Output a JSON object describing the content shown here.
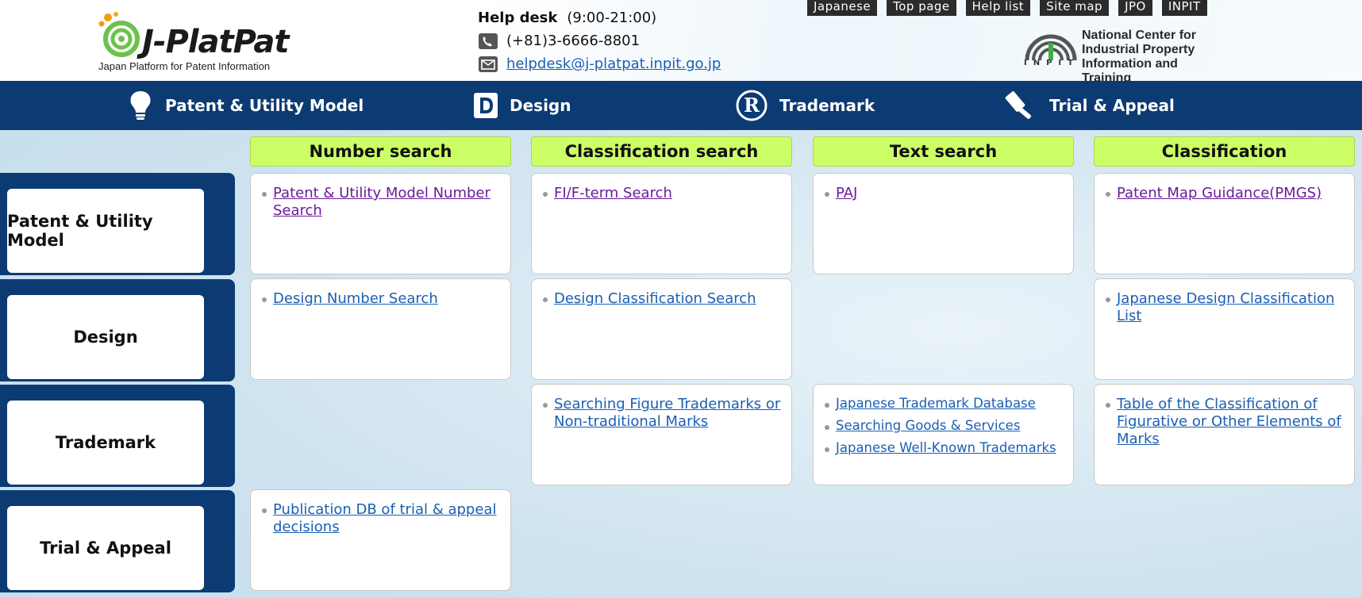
{
  "header": {
    "logo_text": "J-PlatPat",
    "logo_tagline": "Japan Platform for Patent Information",
    "help_title": "Help desk",
    "help_hours": "(9:00-21:00)",
    "help_phone": "(+81)3-6666-8801",
    "help_email": "helpdesk@j-platpat.inpit.go.jp",
    "top_links": [
      "Japanese",
      "Top page",
      "Help list",
      "Site map",
      "JPO",
      "INPIT"
    ],
    "inpit_name_lines": [
      "National Center for",
      "Industrial Property",
      "Information and Training"
    ],
    "inpit_abbr": "INPIT"
  },
  "nav": {
    "items": [
      {
        "label": "Patent & Utility Model",
        "icon": "lightbulb-icon"
      },
      {
        "label": "Design",
        "icon": "design-d-icon"
      },
      {
        "label": "Trademark",
        "icon": "registered-r-icon"
      },
      {
        "label": "Trial & Appeal",
        "icon": "gavel-icon"
      }
    ]
  },
  "columns": [
    "Number search",
    "Classification search",
    "Text search",
    "Classification"
  ],
  "rows": [
    "Patent & Utility Model",
    "Design",
    "Trademark",
    "Trial & Appeal"
  ],
  "cells": {
    "patent_number": [
      "Patent & Utility Model Number Search"
    ],
    "patent_class": [
      "FI/F-term Search"
    ],
    "patent_text": [
      "PAJ"
    ],
    "patent_classification": [
      "Patent Map Guidance(PMGS)"
    ],
    "design_number": [
      "Design Number Search"
    ],
    "design_class": [
      "Design Classification Search"
    ],
    "design_classification": [
      "Japanese Design Classification List"
    ],
    "tm_class": [
      "Searching Figure Trademarks or Non-traditional Marks"
    ],
    "tm_text": [
      "Japanese Trademark Database",
      "Searching Goods & Services",
      "Japanese Well-Known Trademarks"
    ],
    "tm_classification": [
      "Table of the Classification of Figurative or Other Elements of Marks"
    ],
    "trial_number": [
      "Publication DB of trial & appeal decisions"
    ]
  },
  "colors": {
    "nav_blue": "#0c3b73",
    "column_header_green": "#ccff66",
    "link_blue": "#1a5fb4",
    "visited_purple": "#6a1b9a"
  }
}
